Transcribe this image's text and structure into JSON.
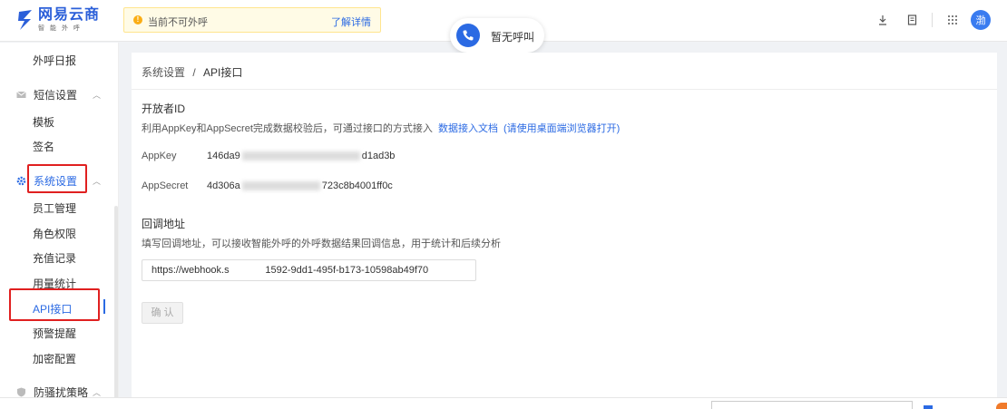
{
  "header": {
    "logo_name": "网易云商",
    "logo_sub": "智能外呼",
    "notice_text": "当前不可外呼",
    "notice_link": "了解详情",
    "call_status": "暂无呼叫",
    "avatar_text": "渤"
  },
  "sidebar": {
    "items": [
      {
        "label": "外呼日报"
      },
      {
        "label": "短信设置"
      },
      {
        "label": "模板"
      },
      {
        "label": "签名"
      },
      {
        "label": "系统设置"
      },
      {
        "label": "员工管理"
      },
      {
        "label": "角色权限"
      },
      {
        "label": "充值记录"
      },
      {
        "label": "用量统计"
      },
      {
        "label": "API接口"
      },
      {
        "label": "预警提醒"
      },
      {
        "label": "加密配置"
      },
      {
        "label": "防骚扰策略"
      }
    ]
  },
  "main": {
    "breadcrumb_parent": "系统设置",
    "breadcrumb_sep": "/",
    "breadcrumb_current": "API接口",
    "developer": {
      "title": "开放者ID",
      "desc": "利用AppKey和AppSecret完成数据校验后，可通过接口的方式接入",
      "doc_link": "数据接入文档",
      "doc_hint": "(请使用桌面端浏览器打开)",
      "appkey_label": "AppKey",
      "appkey_start": "146da9",
      "appkey_end": "d1ad3b",
      "appsecret_label": "AppSecret",
      "appsecret_start": "4d306a",
      "appsecret_end": "723c8b4001ff0c"
    },
    "callback": {
      "title": "回调地址",
      "desc": "填写回调地址，可以接收智能外呼的外呼数据结果回调信息，用于统计和后续分析",
      "url_value": "https://webhook.s             1592-9dd1-495f-b173-10598ab49f70"
    },
    "confirm_label": "确 认"
  },
  "colors": {
    "accent": "#2b6ae3",
    "highlight_box": "#e02020",
    "notice_bg": "#fffbe6"
  }
}
